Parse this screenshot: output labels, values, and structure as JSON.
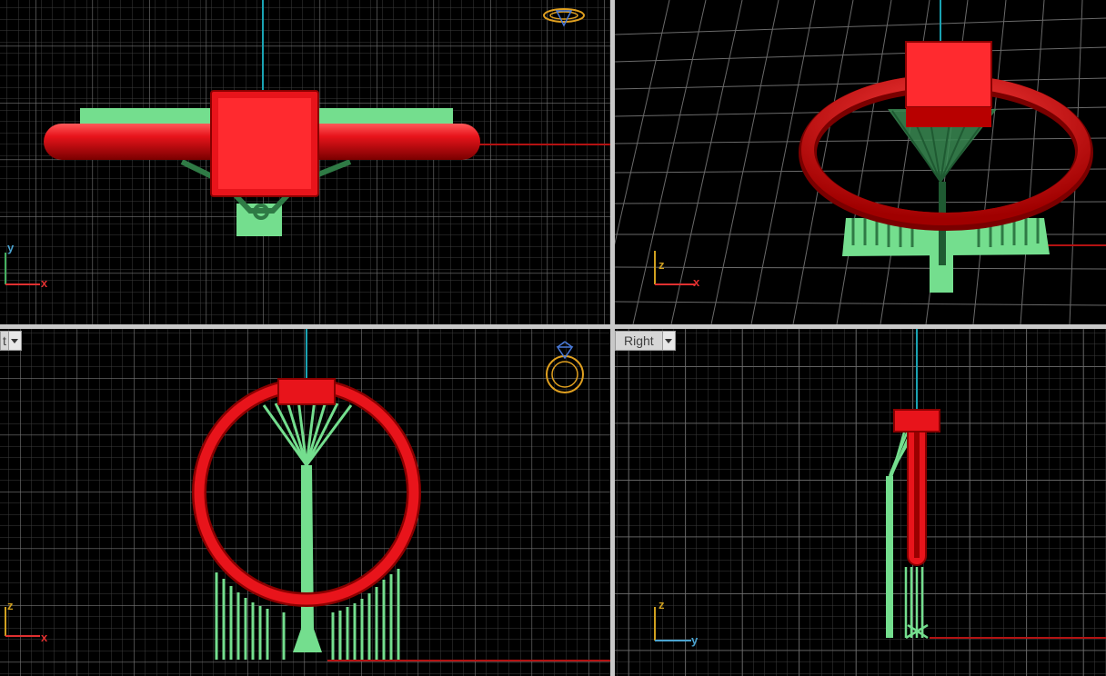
{
  "viewports": {
    "top": {
      "label": "",
      "axis_v": "y",
      "axis_h": "x"
    },
    "perspective": {
      "label": "",
      "axis_v": "z",
      "axis_h": "x"
    },
    "front": {
      "label": "t",
      "axis_v": "z",
      "axis_h": "x"
    },
    "right": {
      "label": "Right",
      "axis_v": "z",
      "axis_h": "y"
    }
  },
  "colors": {
    "background": "#000000",
    "grid_minor": "#3c3c3c",
    "grid_major": "#777777",
    "model_red": "#e8141b",
    "support_green": "#74de8e",
    "axis_red": "#b41212",
    "axis_blue": "#1aa3b3",
    "axis_x_red": "#e03030",
    "axis_y_green": "#45b060",
    "axis_yellow": "#d0a020",
    "axis_y_blue": "#4aa3d0"
  },
  "icons": [
    "ring-gizmo-icon",
    "ring-gizmo-icon",
    "dropdown-arrow-icon"
  ]
}
